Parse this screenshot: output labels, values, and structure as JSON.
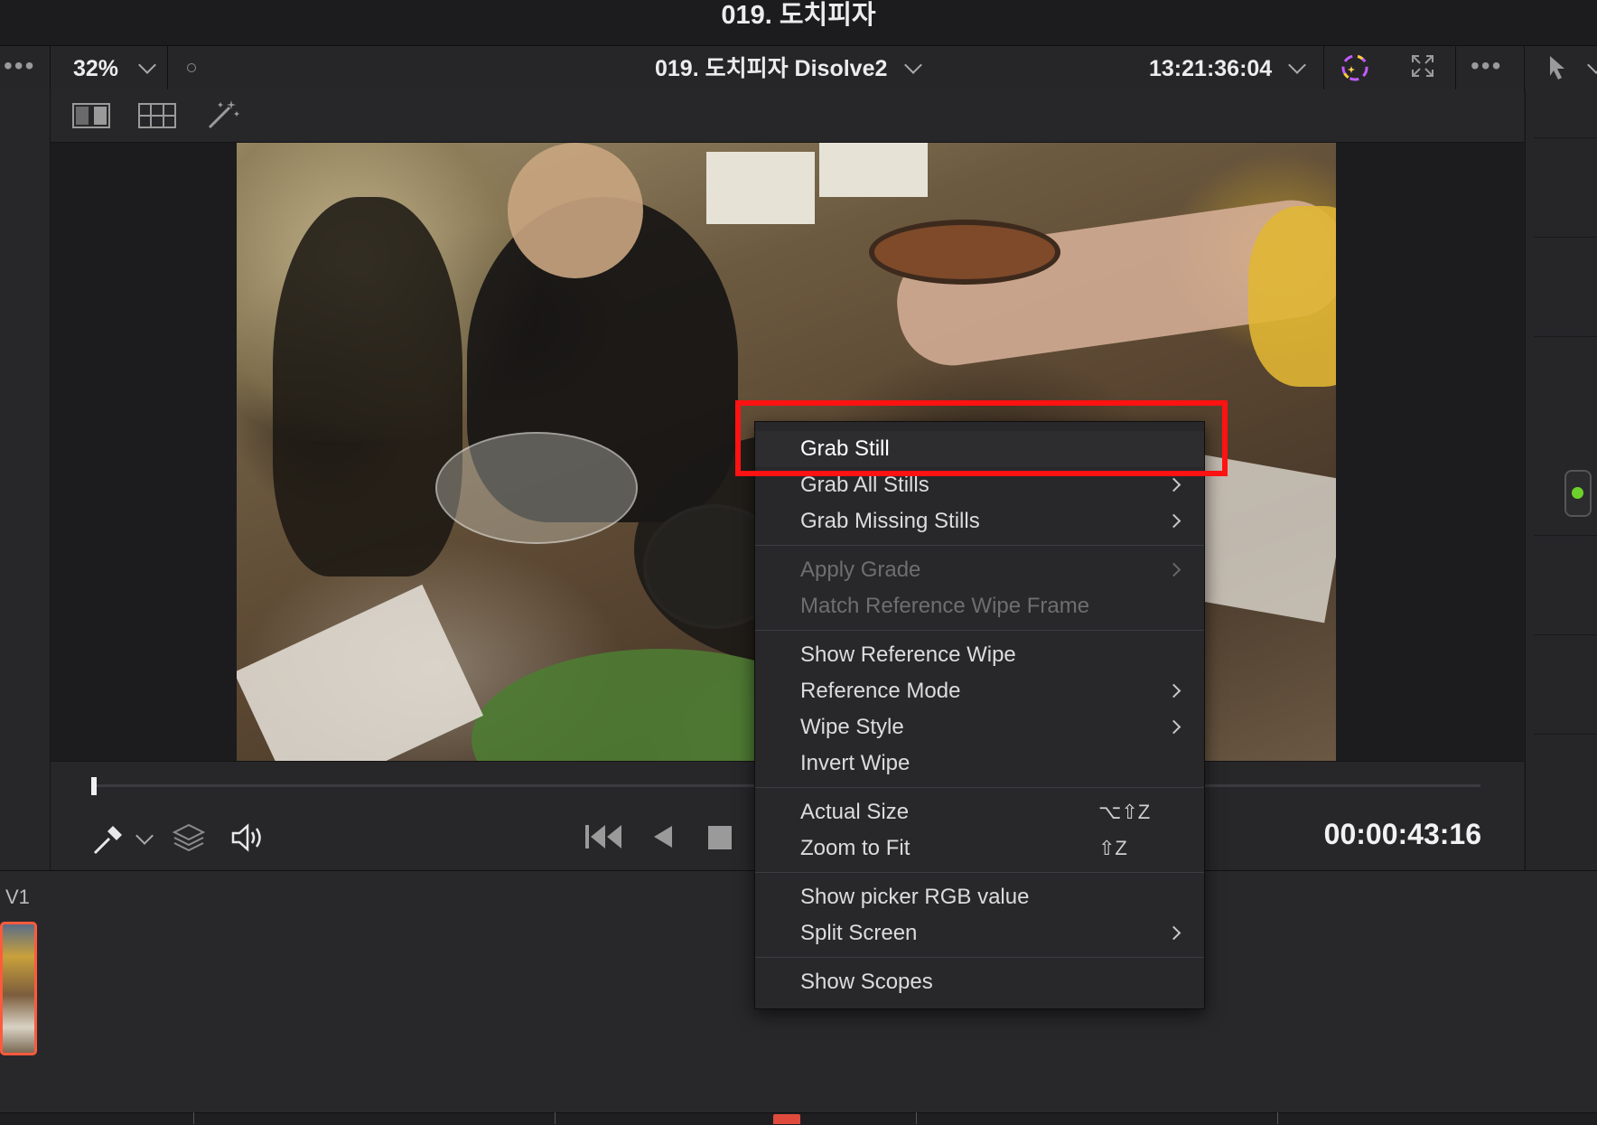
{
  "window": {
    "title": "019. 도치피자"
  },
  "viewer_header": {
    "zoom": "32%",
    "clip_name": "019. 도치피자 Disolve2",
    "source_timecode": "13:21:36:04"
  },
  "transport": {
    "timecode": "00:00:43:16"
  },
  "timeline": {
    "track_label": "V1"
  },
  "context_menu": {
    "groups": [
      [
        {
          "label": "Grab Still",
          "highlighted": true
        },
        {
          "label": "Grab All Stills",
          "submenu": true
        },
        {
          "label": "Grab Missing Stills",
          "submenu": true
        }
      ],
      [
        {
          "label": "Apply Grade",
          "submenu": true,
          "disabled": true
        },
        {
          "label": "Match Reference Wipe Frame",
          "disabled": true
        }
      ],
      [
        {
          "label": "Show Reference Wipe"
        },
        {
          "label": "Reference Mode",
          "submenu": true
        },
        {
          "label": "Wipe Style",
          "submenu": true
        },
        {
          "label": "Invert Wipe"
        }
      ],
      [
        {
          "label": "Actual Size",
          "shortcut": "⌥⇧Z"
        },
        {
          "label": "Zoom to Fit",
          "shortcut": "⇧Z"
        }
      ],
      [
        {
          "label": "Show picker RGB value"
        },
        {
          "label": "Split Screen",
          "submenu": true
        }
      ],
      [
        {
          "label": "Show Scopes"
        }
      ]
    ]
  },
  "colors": {
    "annotation_box": "#ff1212",
    "clip_border": "#ff5a3c",
    "status_dot": "#6ed12a"
  },
  "icons": [
    "more-dots-icon",
    "chevron-down-icon",
    "color-wheel-icon",
    "fullscreen-icon",
    "pointer-icon",
    "split-view-icon",
    "gallery-icon",
    "magic-wand-icon",
    "eyedropper-icon",
    "layers-icon",
    "speaker-icon",
    "skip-to-start-icon",
    "play-reverse-icon",
    "stop-icon"
  ]
}
